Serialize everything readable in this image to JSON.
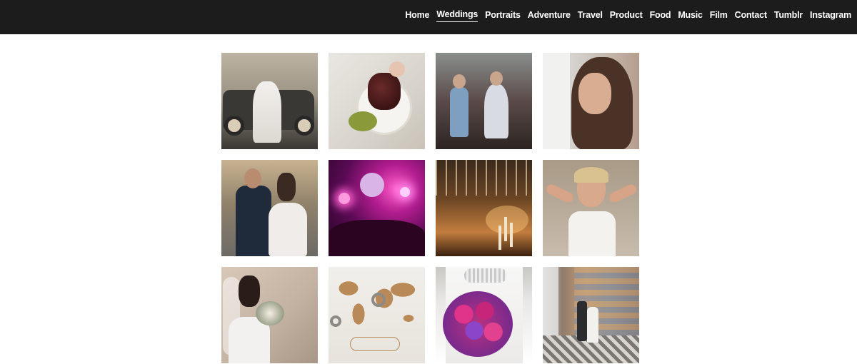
{
  "nav": {
    "items": [
      {
        "label": "Home",
        "active": false
      },
      {
        "label": "Weddings",
        "active": true
      },
      {
        "label": "Portraits",
        "active": false
      },
      {
        "label": "Adventure",
        "active": false
      },
      {
        "label": "Travel",
        "active": false
      },
      {
        "label": "Product",
        "active": false
      },
      {
        "label": "Food",
        "active": false
      },
      {
        "label": "Music",
        "active": false
      },
      {
        "label": "Film",
        "active": false
      },
      {
        "label": "Contact",
        "active": false
      },
      {
        "label": "Tumblr",
        "active": false
      },
      {
        "label": "Instagram",
        "active": false
      }
    ]
  },
  "colors": {
    "topbar_bg": "#1c1c1c",
    "nav_text": "#ffffff",
    "page_bg": "#ffffff"
  }
}
